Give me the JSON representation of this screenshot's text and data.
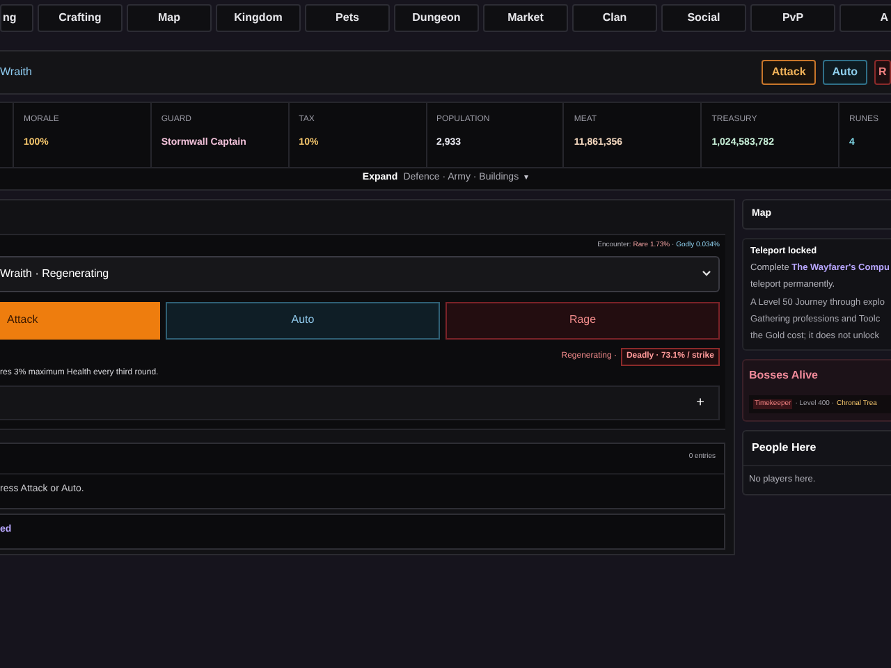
{
  "nav_tabs": [
    {
      "label": "ng",
      "selected": false
    },
    {
      "label": "Crafting",
      "selected": false
    },
    {
      "label": "Map",
      "selected": false
    },
    {
      "label": "Kingdom",
      "selected": false
    },
    {
      "label": "Pets",
      "selected": false
    },
    {
      "label": "Dungeon",
      "selected": false
    },
    {
      "label": "Market",
      "selected": false
    },
    {
      "label": "Clan",
      "selected": false
    },
    {
      "label": "Social",
      "selected": false
    },
    {
      "label": "PvP",
      "selected": false
    },
    {
      "label": "A",
      "selected": false
    }
  ],
  "header": {
    "title": "Wraith",
    "actions": [
      {
        "label": "Attack",
        "kind": "attack"
      },
      {
        "label": "Auto",
        "kind": "auto"
      },
      {
        "label": "R",
        "kind": "rage"
      }
    ]
  },
  "stats": [
    {
      "label": "MORALE",
      "value": "100%",
      "color": "#f2c46b"
    },
    {
      "label": "GUARD",
      "value": "Stormwall Captain",
      "color": "#f0c0d8"
    },
    {
      "label": "TAX",
      "value": "10%",
      "color": "#f2c46b"
    },
    {
      "label": "POPULATION",
      "value": "2,933",
      "color": "#e8e8f0"
    },
    {
      "label": "MEAT",
      "value": "11,861,356",
      "color": "#f5d9c0"
    },
    {
      "label": "TREASURY",
      "value": "1,024,583,782",
      "color": "#c8f0d8"
    },
    {
      "label": "RUNES",
      "value": "4",
      "color": "#7fd8e8"
    }
  ],
  "expand": {
    "label": "Expand",
    "sections": "Defence · Army · Buildings",
    "caret": "▾"
  },
  "encounter": {
    "label": "Encounter:",
    "rare": "Rare 1.73%",
    "separator": "·",
    "godly": "Godly 0.034%"
  },
  "monster_select": {
    "value": "Wraith · Regenerating"
  },
  "battle_buttons": [
    {
      "label": "Attack",
      "kind": "attack",
      "selected": true
    },
    {
      "label": "Auto",
      "kind": "auto",
      "selected": false
    },
    {
      "label": "Rage",
      "kind": "rage",
      "selected": false
    }
  ],
  "status": {
    "trait": "Regenerating ·",
    "threat": "Deadly · 73.1% / strike"
  },
  "trait_description": "res 3% maximum Health every third round.",
  "expander": {
    "icon": "+"
  },
  "log": {
    "count": "0 entries",
    "empty_text": "ress Attack or Auto."
  },
  "footer_link": "ed",
  "map_panel": {
    "title": "Map"
  },
  "teleport": {
    "title": "Teleport locked",
    "line_1_prefix": "Complete",
    "quest_link": "The Wayfarer's Compu",
    "line_2": "teleport permanently.",
    "details": [
      "A Level 50 Journey through explo",
      "Gathering professions and Toolc",
      "the Gold cost; it does not unlock"
    ]
  },
  "bosses": {
    "title": "Bosses Alive",
    "rows": [
      {
        "name": "Timekeeper",
        "separator": "·",
        "level": "Level 400",
        "separator_2": "·",
        "reward": "Chronal Trea"
      }
    ]
  },
  "people": {
    "title": "People Here",
    "empty_text": "No players here."
  }
}
